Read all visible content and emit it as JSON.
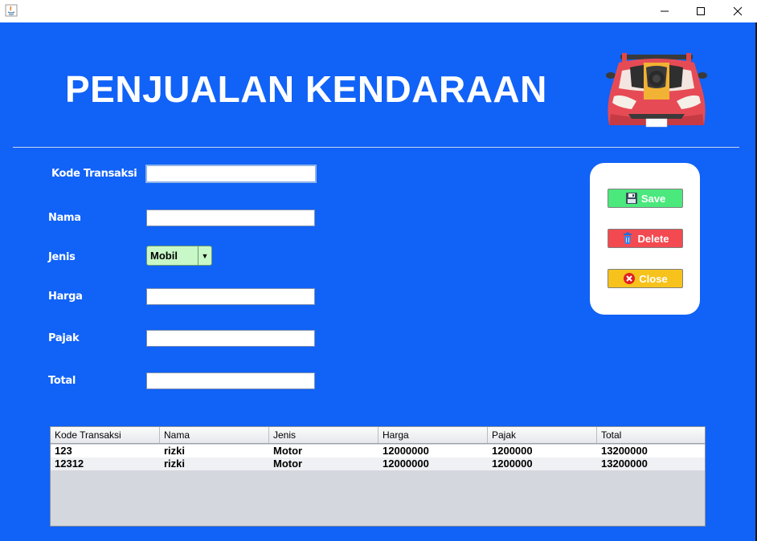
{
  "window": {
    "minimize_glyph": "—",
    "close_glyph": "✕"
  },
  "header": {
    "title": "PENJUALAN KENDARAAN",
    "logo_icon": "sports-car-icon"
  },
  "form": {
    "kode_transaksi": {
      "label": "Kode Transaksi",
      "value": ""
    },
    "nama": {
      "label": "Nama",
      "value": ""
    },
    "jenis": {
      "label": "Jenis",
      "value": "Mobil"
    },
    "harga": {
      "label": "Harga",
      "value": ""
    },
    "pajak": {
      "label": "Pajak",
      "value": ""
    },
    "total": {
      "label": "Total",
      "value": ""
    }
  },
  "actions": {
    "save": {
      "label": "Save",
      "icon": "floppy-disk-icon",
      "color": "#4BE87D"
    },
    "delete": {
      "label": "Delete",
      "icon": "trash-icon",
      "color": "#F24A50"
    },
    "close": {
      "label": "Close",
      "icon": "close-circle-icon",
      "color": "#F7C21B"
    }
  },
  "table": {
    "columns": [
      "Kode Transaksi",
      "Nama",
      "Jenis",
      "Harga",
      "Pajak",
      "Total"
    ],
    "rows": [
      [
        "123",
        "rizki",
        "Motor",
        "12000000",
        "1200000",
        "13200000"
      ],
      [
        "12312",
        "rizki",
        "Motor",
        "12000000",
        "1200000",
        "13200000"
      ]
    ]
  },
  "colors": {
    "background": "#1162F7",
    "panel": "#FFFFFF"
  }
}
